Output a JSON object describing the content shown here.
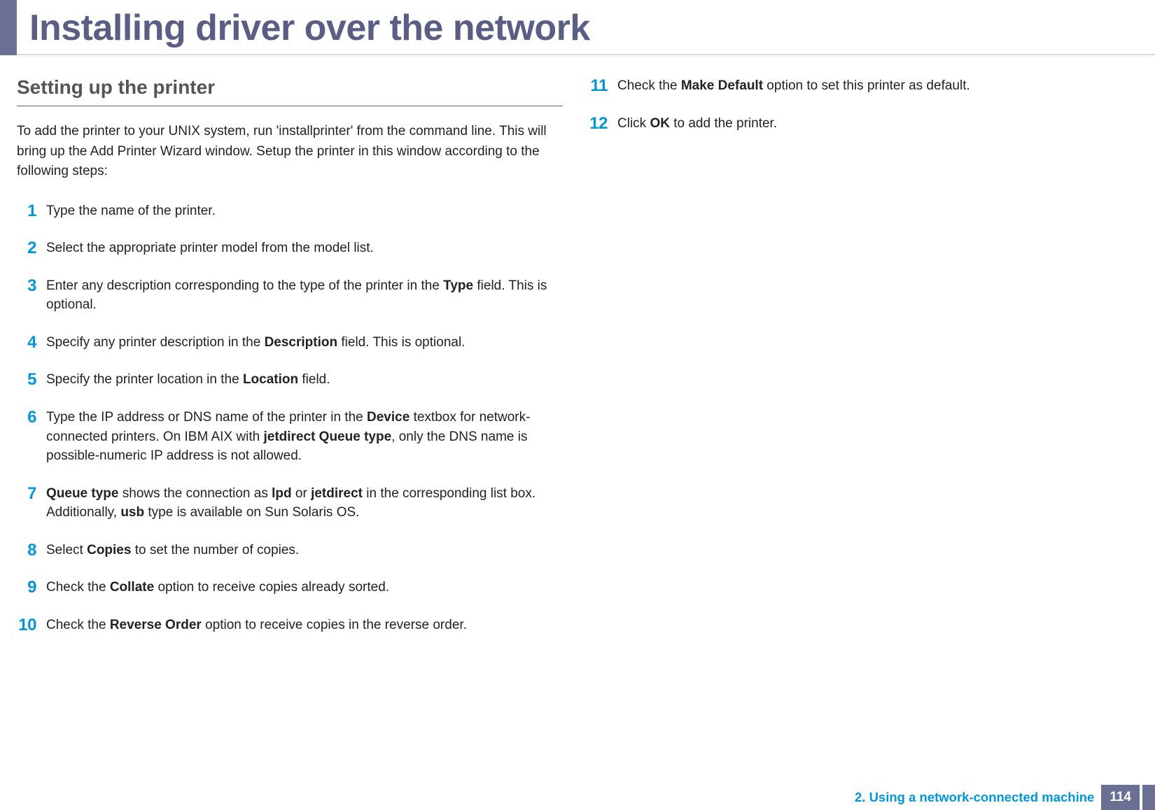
{
  "header": {
    "title": "Installing driver over the network"
  },
  "section": {
    "heading": "Setting up the printer",
    "intro": "To add the printer to your UNIX system, run 'installprinter' from the command line. This will bring up the Add Printer Wizard window. Setup the printer in this window according to the following steps:"
  },
  "steps_left": [
    {
      "num": "1",
      "html": "Type the name of the printer."
    },
    {
      "num": "2",
      "html": "Select the appropriate printer model from the model list."
    },
    {
      "num": "3",
      "html": "Enter any description corresponding to the type of the printer in the <b>Type</b> field. This is optional."
    },
    {
      "num": "4",
      "html": "Specify any printer description in the <b>Description</b> field. This is optional."
    },
    {
      "num": "5",
      "html": "Specify the printer location in the <b>Location</b> field."
    },
    {
      "num": "6",
      "html": "Type the IP address or DNS name of the printer in the <b>Device</b> textbox for network-connected printers. On IBM AIX with <b>jetdirect Queue type</b>, only the DNS name is possible-numeric IP address is not allowed."
    },
    {
      "num": "7",
      "html": "<b>Queue type</b> shows the connection as <b>lpd</b> or <b>jetdirect</b> in the corresponding list box. Additionally, <b>usb</b> type is available on Sun Solaris OS."
    },
    {
      "num": "8",
      "html": "Select <b>Copies</b> to set the number of copies."
    },
    {
      "num": "9",
      "html": "Check the <b>Collate</b> option to receive copies already sorted."
    },
    {
      "num": "10",
      "html": "Check the <b>Reverse Order</b> option to receive copies in the reverse order."
    }
  ],
  "steps_right": [
    {
      "num": "11",
      "html": "Check the <b>Make Default</b> option to set this printer as default."
    },
    {
      "num": "12",
      "html": "Click <b>OK</b> to add the printer."
    }
  ],
  "footer": {
    "chapter": "2.  Using a network-connected machine",
    "page": "114"
  }
}
